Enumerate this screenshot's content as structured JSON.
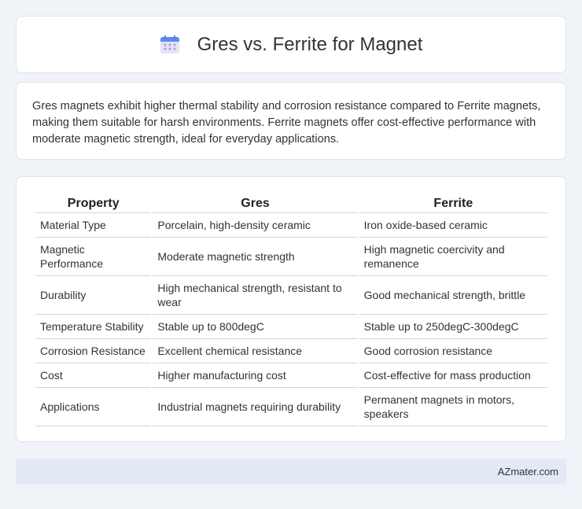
{
  "header": {
    "icon": "calendar-icon",
    "title": "Gres vs. Ferrite for Magnet"
  },
  "summary": {
    "text": "Gres magnets exhibit higher thermal stability and corrosion resistance compared to Ferrite magnets, making them suitable for harsh environments. Ferrite magnets offer cost-effective performance with moderate magnetic strength, ideal for everyday applications."
  },
  "table": {
    "headers": [
      "Property",
      "Gres",
      "Ferrite"
    ],
    "rows": [
      [
        "Material Type",
        "Porcelain, high-density ceramic",
        "Iron oxide-based ceramic"
      ],
      [
        "Magnetic Performance",
        "Moderate magnetic strength",
        "High magnetic coercivity and remanence"
      ],
      [
        "Durability",
        "High mechanical strength, resistant to wear",
        "Good mechanical strength, brittle"
      ],
      [
        "Temperature Stability",
        "Stable up to 800degC",
        "Stable up to 250degC-300degC"
      ],
      [
        "Corrosion Resistance",
        "Excellent chemical resistance",
        "Good corrosion resistance"
      ],
      [
        "Cost",
        "Higher manufacturing cost",
        "Cost-effective for mass production"
      ],
      [
        "Applications",
        "Industrial magnets requiring durability",
        "Permanent magnets in motors, speakers"
      ]
    ]
  },
  "footer": {
    "site": "AZmater.com"
  }
}
